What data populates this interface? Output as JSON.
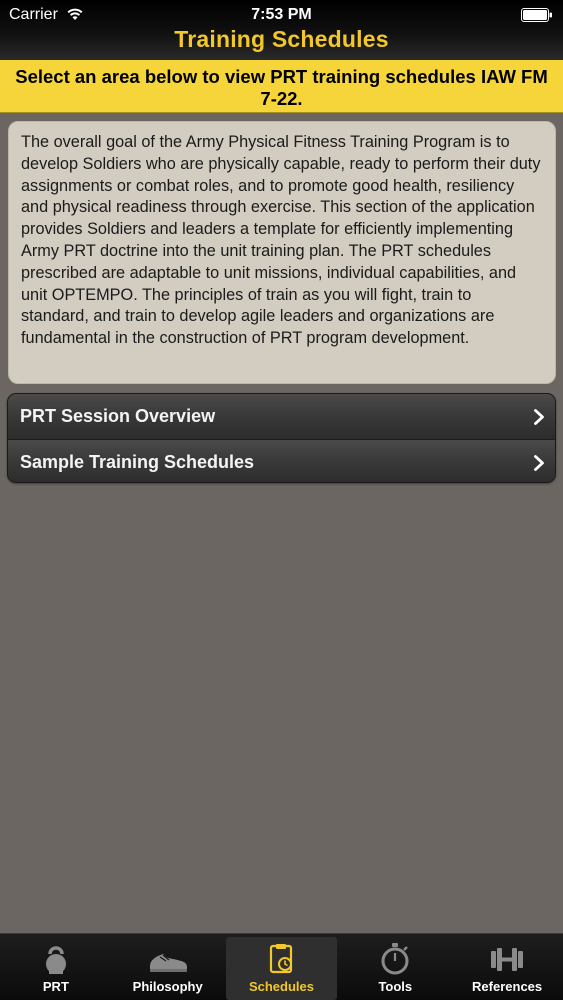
{
  "status_bar": {
    "carrier": "Carrier",
    "time": "7:53 PM"
  },
  "header": {
    "title": "Training Schedules"
  },
  "banner": {
    "text": "Select an area below to view PRT training schedules IAW FM 7-22."
  },
  "intro": {
    "text": "The overall goal of the Army Physical Fitness Training Program is to develop Soldiers who are physically capable, ready to perform their duty assignments or combat roles, and to promote good health, resiliency and physical readiness through exercise. This section of the application provides Soldiers and leaders a template for efficiently implementing Army PRT doctrine into the unit training plan. The PRT schedules prescribed are adaptable to unit missions, individual capabilities, and unit OPTEMPO. The principles of train as you will fight, train to standard, and train to develop agile leaders and organizations are fundamental in the construction of PRT program development."
  },
  "menu": {
    "items": [
      {
        "label": "PRT Session Overview",
        "icon": "chevron-right-icon"
      },
      {
        "label": "Sample Training Schedules",
        "icon": "chevron-right-icon"
      }
    ]
  },
  "tab_bar": {
    "tabs": [
      {
        "label": "PRT",
        "icon": "kettlebell-icon"
      },
      {
        "label": "Philosophy",
        "icon": "running-shoe-icon"
      },
      {
        "label": "Schedules",
        "icon": "clipboard-clock-icon"
      },
      {
        "label": "Tools",
        "icon": "stopwatch-icon"
      },
      {
        "label": "References",
        "icon": "dumbbell-icon"
      }
    ],
    "active_tab": "Schedules"
  },
  "colors": {
    "accent_yellow": "#f2c72b",
    "banner_yellow": "#f6d53b",
    "background": "#6b6661",
    "card_background": "#d2ccc1"
  }
}
